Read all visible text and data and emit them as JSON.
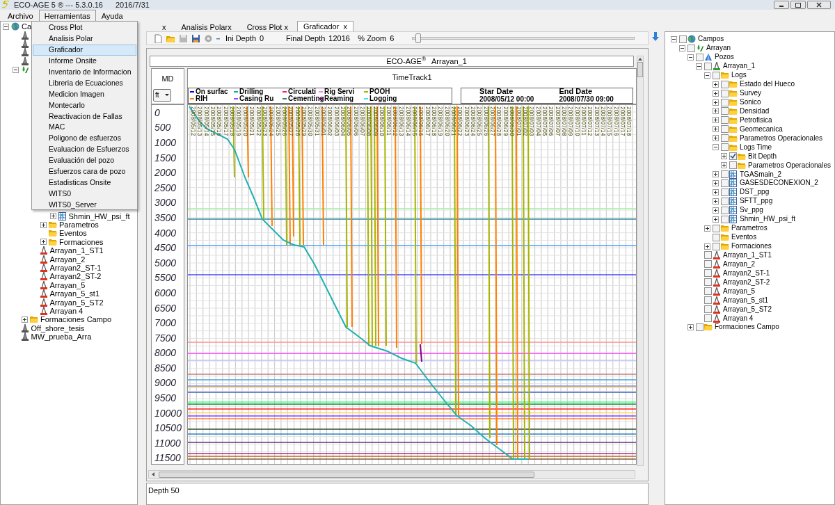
{
  "window": {
    "title": "ECO-AGE 5 ® --- 5.3.0.16",
    "date": "2016/7/31"
  },
  "menu_bar": [
    {
      "label": "Archivo",
      "selected": false
    },
    {
      "label": "Herramientas",
      "selected": true
    },
    {
      "label": "Ayuda",
      "selected": false
    }
  ],
  "dropdown_menu": [
    {
      "label": "Cross Plot",
      "selected": false
    },
    {
      "label": "Analisis Polar",
      "selected": false
    },
    {
      "label": "Graficador",
      "selected": true
    },
    {
      "label": "Informe Onsite",
      "selected": false
    },
    {
      "label": "Inventario de Informacion",
      "selected": false
    },
    {
      "label": "Libreria de Ecuaciones",
      "selected": false
    },
    {
      "label": "Medicion Imagen",
      "selected": false
    },
    {
      "label": "Montecarlo",
      "selected": false
    },
    {
      "label": "Reactivacion de Fallas",
      "selected": false
    },
    {
      "label": "MAC",
      "selected": false
    },
    {
      "label": "Poligono de esfuerzos",
      "selected": false
    },
    {
      "label": "Evaluacion de Esfuerzos",
      "selected": false
    },
    {
      "label": "Evaluación del pozo",
      "selected": false
    },
    {
      "label": "Esfuerzos cara de pozo",
      "selected": false
    },
    {
      "label": "Estadisticas Onsite",
      "selected": false
    },
    {
      "label": "WITS0",
      "selected": false
    },
    {
      "label": "WITS0_Server",
      "selected": false
    }
  ],
  "left_tree": [
    {
      "label": "Ca",
      "kind": "globe",
      "expanded": true,
      "children": [
        {
          "kind": "rig"
        },
        {
          "kind": "rig"
        },
        {
          "kind": "rig"
        },
        {
          "kind": "rig"
        },
        {
          "kind": "field",
          "expanded": true,
          "children": [
            {
              "children": [
                {
                  "children": [
                    {
                      "children": [
                        {
                          "label": "Shmin_HW_psi_ft",
                          "kind": "log",
                          "expanded": false
                        }
                      ]
                    },
                    {
                      "label": "Parametros",
                      "kind": "folder",
                      "expanded": false
                    },
                    {
                      "label": "Eventos",
                      "kind": "folder"
                    },
                    {
                      "label": "Formaciones",
                      "kind": "folder",
                      "expanded": false
                    }
                  ]
                },
                {
                  "label": "Arrayan_1_ST1",
                  "kind": "well-red"
                },
                {
                  "label": "Arrayan_2",
                  "kind": "well-red"
                },
                {
                  "label": "Arrayan2_ST-1",
                  "kind": "well-red"
                },
                {
                  "label": "Arrayan2_ST-2",
                  "kind": "well-red"
                },
                {
                  "label": "Arrayan_5",
                  "kind": "well-red"
                },
                {
                  "label": "Arrayan_5_st1",
                  "kind": "well-red"
                },
                {
                  "label": "Arrayan_5_ST2",
                  "kind": "well-red"
                },
                {
                  "label": "Arrayan 4",
                  "kind": "well-red"
                }
              ]
            },
            {
              "label": "Formaciones Campo",
              "kind": "folder",
              "expanded": false
            }
          ]
        },
        {
          "label": "Off_shore_tesis",
          "kind": "rig"
        },
        {
          "label": "MW_prueba_Arra",
          "kind": "rig"
        }
      ]
    }
  ],
  "tabs": [
    {
      "label": "x",
      "selected": false
    },
    {
      "label": "Analisis Polarx",
      "selected": false
    },
    {
      "label": "Cross Plot x",
      "selected": false
    },
    {
      "label": "Graficador  x",
      "selected": true
    }
  ],
  "toolbar": {
    "ini_depth_label": "Ini Depth",
    "ini_depth": "0",
    "final_depth_label": "Final Depth",
    "final_depth": "12016",
    "zoom_label": "% Zoom",
    "zoom": "6",
    "zoom_slider": {
      "level": 0.01
    }
  },
  "plot": {
    "title": "ECO-AGE$^{®}$",
    "well": "Arrayan_1",
    "md_track": {
      "title": "MD",
      "unit": "ft",
      "ticks": [
        "0",
        "500",
        "1000",
        "1500",
        "2000",
        "2500",
        "3000",
        "3500",
        "4000",
        "4500",
        "5000",
        "5500",
        "6000",
        "6500",
        "7000",
        "7500",
        "8000",
        "8500",
        "9000",
        "9500",
        "10000",
        "10500",
        "11000",
        "11500"
      ]
    },
    "time_track": {
      "title": "TimeTrack1",
      "legend": [
        {
          "label": "On surfac",
          "color": "#0000ff"
        },
        {
          "label": "Drilling",
          "color": "#00b0a0"
        },
        {
          "label": "Circulati",
          "color": "#ff2060"
        },
        {
          "label": "Rig Servi",
          "color": "#ff80ff"
        },
        {
          "label": "POOH",
          "color": "#a8b400"
        },
        {
          "label": "RIH",
          "color": "#ff7f00"
        },
        {
          "label": "Casing Ru",
          "color": "#a040ff"
        },
        {
          "label": "Cementing",
          "color": "#308080"
        },
        {
          "label": "Reaming",
          "color": "#800080"
        },
        {
          "label": "Logging",
          "color": "#40e0ff"
        }
      ],
      "start_label": "Star Date",
      "start": "2008/05/12 00:00",
      "end_label": "End Date",
      "end": "2008/07/30 09:00",
      "dates": [
        "2008/05/12",
        "2008/05/13",
        "2008/05/14",
        "2008/05/15",
        "2008/05/16",
        "2008/05/17",
        "2008/05/18",
        "2008/05/19",
        "2008/05/20",
        "2008/05/21",
        "2008/05/22",
        "2008/05/23",
        "2008/05/24",
        "2008/05/25",
        "2008/05/26",
        "2008/05/27",
        "2008/05/28",
        "2008/05/29",
        "2008/05/30",
        "2008/05/31",
        "2008/06/01",
        "2008/06/02",
        "2008/06/03",
        "2008/06/04",
        "2008/06/05",
        "2008/06/06",
        "2008/06/07",
        "2008/06/08",
        "2008/06/09",
        "2008/06/10",
        "2008/06/11",
        "2008/06/12",
        "2008/06/13",
        "2008/06/14",
        "2008/06/15",
        "2008/06/16",
        "2008/06/17",
        "2008/06/18",
        "2008/06/19",
        "2008/06/20",
        "2008/06/21",
        "2008/06/22",
        "2008/06/23",
        "2008/06/24",
        "2008/06/25",
        "2008/06/26",
        "2008/06/27",
        "2008/06/28",
        "2008/06/29",
        "2008/06/30",
        "2008/07/01",
        "2008/07/02",
        "2008/07/03",
        "2008/07/04",
        "2008/07/05",
        "2008/07/06",
        "2008/07/07",
        "2008/07/08",
        "2008/07/09",
        "2008/07/10",
        "2008/07/11",
        "2008/07/12",
        "2008/07/13",
        "2008/07/14",
        "2008/07/15",
        "2008/07/16",
        "2008/07/17",
        "2008/07/18"
      ]
    }
  },
  "status_bar": "Depth 50",
  "right_tree": [
    {
      "label": "Campos",
      "kind": "globe",
      "expanded": true,
      "checked": false,
      "children": [
        {
          "label": "Arrayan",
          "kind": "field",
          "expanded": true,
          "checked": false,
          "children": [
            {
              "label": "Pozos",
              "kind": "wells",
              "expanded": true,
              "checked": false,
              "children": [
                {
                  "label": "Arrayan_1",
                  "kind": "well",
                  "expanded": true,
                  "checked": false,
                  "children": [
                    {
                      "label": "Logs",
                      "kind": "folder",
                      "expanded": true,
                      "checked": false,
                      "children": [
                        {
                          "label": "Estado del Hueco",
                          "kind": "folder",
                          "expanded": false,
                          "checked": false
                        },
                        {
                          "label": "Survey",
                          "kind": "folder",
                          "expanded": false,
                          "checked": false
                        },
                        {
                          "label": "Sonico",
                          "kind": "folder",
                          "expanded": false,
                          "checked": false
                        },
                        {
                          "label": "Densidad",
                          "kind": "folder",
                          "expanded": false,
                          "checked": false
                        },
                        {
                          "label": "Petrofisica",
                          "kind": "folder",
                          "expanded": false,
                          "checked": false
                        },
                        {
                          "label": "Geomecanica",
                          "kind": "folder",
                          "expanded": false,
                          "checked": false
                        },
                        {
                          "label": "Parametros Operacionales",
                          "kind": "folder",
                          "expanded": false,
                          "checked": false
                        },
                        {
                          "label": "Logs Time",
                          "kind": "folder",
                          "expanded": true,
                          "checked": false,
                          "children": [
                            {
                              "label": "Bit Depth",
                              "kind": "folder",
                              "expanded": false,
                              "checked": true
                            },
                            {
                              "label": "Parametros Operacionales",
                              "kind": "folder",
                              "expanded": false,
                              "checked": false
                            }
                          ]
                        },
                        {
                          "label": "TGASmain_2",
                          "kind": "log",
                          "expanded": false,
                          "checked": false
                        },
                        {
                          "label": "GASESDECONEXION_2",
                          "kind": "log",
                          "expanded": false,
                          "checked": false
                        },
                        {
                          "label": "DST_ppg",
                          "kind": "log",
                          "expanded": false,
                          "checked": false
                        },
                        {
                          "label": "SFTT_ppg",
                          "kind": "log",
                          "expanded": false,
                          "checked": false
                        },
                        {
                          "label": "Sv_ppg",
                          "kind": "log",
                          "expanded": false,
                          "checked": false
                        },
                        {
                          "label": "Shmin_HW_psi_ft",
                          "kind": "log",
                          "expanded": false,
                          "checked": false
                        }
                      ]
                    },
                    {
                      "label": "Parametros",
                      "kind": "folder",
                      "expanded": false,
                      "checked": false
                    },
                    {
                      "label": "Eventos",
                      "kind": "folder",
                      "checked": false
                    },
                    {
                      "label": "Formaciones",
                      "kind": "folder",
                      "expanded": false,
                      "checked": false
                    }
                  ]
                },
                {
                  "label": "Arrayan_1_ST1",
                  "kind": "well-red",
                  "checked": false
                },
                {
                  "label": "Arrayan_2",
                  "kind": "well-red",
                  "checked": false
                },
                {
                  "label": "Arrayan2_ST-1",
                  "kind": "well-red",
                  "checked": false
                },
                {
                  "label": "Arrayan2_ST-2",
                  "kind": "well-red",
                  "checked": false
                },
                {
                  "label": "Arrayan_5",
                  "kind": "well-red",
                  "checked": false
                },
                {
                  "label": "Arrayan_5_st1",
                  "kind": "well-red",
                  "checked": false
                },
                {
                  "label": "Arrayan_5_ST2",
                  "kind": "well-red",
                  "checked": false
                },
                {
                  "label": "Arrayan 4",
                  "kind": "well-red",
                  "checked": false
                }
              ]
            },
            {
              "label": "Formaciones Campo",
              "kind": "folder",
              "expanded": false,
              "checked": false
            }
          ]
        }
      ]
    }
  ]
}
